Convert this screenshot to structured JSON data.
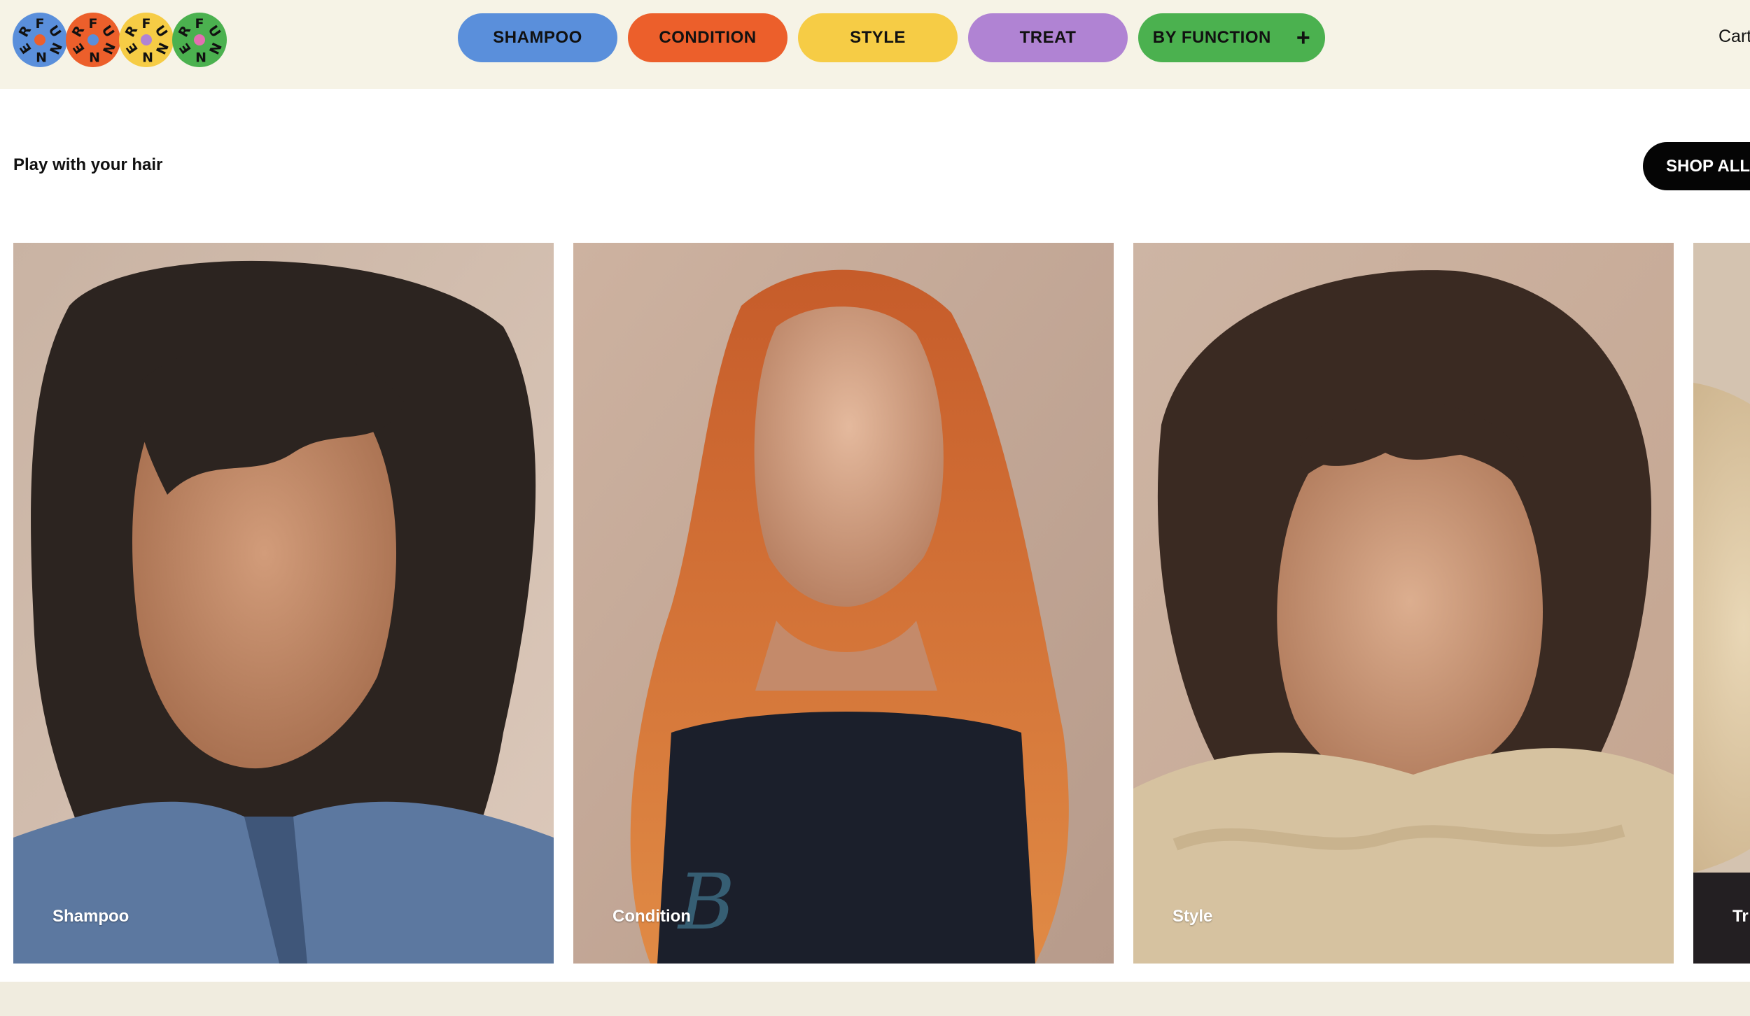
{
  "header": {
    "logo": {
      "alt_letters": [
        "R",
        "F",
        "U",
        "N",
        "N",
        "E"
      ],
      "discs": [
        {
          "color": "#5a8fdb",
          "dot": "#ec5f2b"
        },
        {
          "color": "#ec5f2b",
          "dot": "#5a8fdb"
        },
        {
          "color": "#f6cc45",
          "dot": "#b083d3"
        },
        {
          "color": "#4bb14f",
          "dot": "#e46fb1"
        }
      ]
    },
    "nav": [
      {
        "label": "SHAMPOO",
        "color": "#5a8fdb"
      },
      {
        "label": "CONDITION",
        "color": "#ec5f2b"
      },
      {
        "label": "STYLE",
        "color": "#f6cc45"
      },
      {
        "label": "TREAT",
        "color": "#b083d3"
      },
      {
        "label": "BY FUNCTION",
        "color": "#4bb14f",
        "icon": "plus-icon"
      }
    ],
    "cart_label": "Cart"
  },
  "intro": {
    "tagline": "Play with your hair",
    "shop_all_label": "SHOP ALL"
  },
  "carousel": {
    "cards": [
      {
        "label": "Shampoo",
        "image": "portrait-dark-wavy-hair-denim-jacket"
      },
      {
        "label": "Condition",
        "image": "portrait-long-red-hair-black-tshirt"
      },
      {
        "label": "Style",
        "image": "portrait-curly-hair-shearling-coat"
      },
      {
        "label": "Tr",
        "image": "portrait-blonde-afro-partial"
      }
    ]
  }
}
